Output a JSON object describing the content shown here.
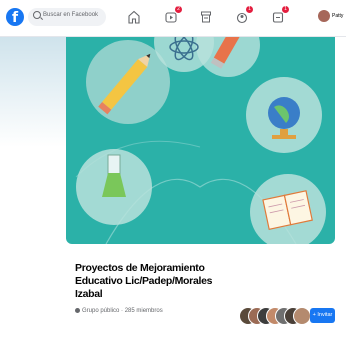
{
  "nav": {
    "logo_letter": "f",
    "search_placeholder": "Buscar en Facebook",
    "user_name": "Patty",
    "badges": {
      "watch": "2",
      "groups": "1",
      "messages": "1"
    }
  },
  "group": {
    "title": "Proyectos de Mejoramiento Educativo Lic/Padep/Morales Izabal",
    "meta": "Grupo público · 285 miembros",
    "invite_label": "+ Invitar"
  },
  "colors": {
    "brand": "#1877f2",
    "cover_teal": "#2bb1a8",
    "notification_red": "#e41e3f"
  },
  "icons": [
    "search-icon",
    "home-icon",
    "watch-icon",
    "marketplace-icon",
    "groups-icon",
    "gaming-icon",
    "avatar",
    "globe-icon"
  ]
}
